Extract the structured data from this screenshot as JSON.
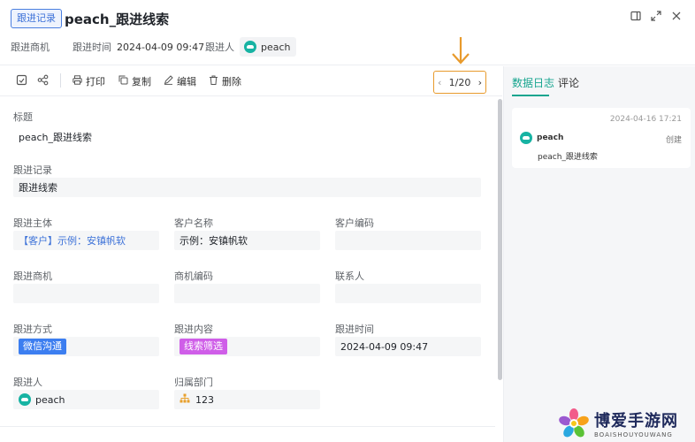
{
  "header": {
    "badge": "跟进记录",
    "title": "peach_跟进线索",
    "meta": {
      "opportunity_label": "跟进商机",
      "time_label": "跟进时间",
      "time_value": "2024-04-09 09:47",
      "person_label": "跟进人",
      "person_value": "peach"
    }
  },
  "toolbar": {
    "print": "打印",
    "copy": "复制",
    "edit": "编辑",
    "delete": "删除",
    "pager": "1/20"
  },
  "form": {
    "title_label": "标题",
    "title_value": "peach_跟进线索",
    "record_label": "跟进记录",
    "record_value": "跟进线索",
    "subject_label": "跟进主体",
    "subject_value": "【客户】示例：安镇帆软",
    "customer_name_label": "客户名称",
    "customer_name_value": "示例：安镇帆软",
    "customer_code_label": "客户编码",
    "customer_code_value": "",
    "opportunity_label": "跟进商机",
    "opportunity_value": "",
    "opportunity_code_label": "商机编码",
    "opportunity_code_value": "",
    "contact_label": "联系人",
    "contact_value": "",
    "method_label": "跟进方式",
    "method_value": "微信沟通",
    "content_label": "跟进内容",
    "content_value": "线索筛选",
    "followup_time_label": "跟进时间",
    "followup_time_value": "2024-04-09 09:47",
    "person_label": "跟进人",
    "person_value": "peach",
    "department_label": "归属部门",
    "department_value": "123"
  },
  "side": {
    "tabs": [
      "数据日志",
      "评论"
    ],
    "active_tab": "数据日志",
    "log": {
      "time": "2024-04-16 17:21",
      "user": "peach",
      "action": "创建",
      "text": "peach_跟进线索"
    }
  },
  "watermark": {
    "title": "博爱手游网",
    "subtitle": "BOAISHOUYOUWANG"
  },
  "colors": {
    "accent": "#17a58f",
    "link": "#3d72d8",
    "tag_blue": "#3c7ef0",
    "tag_purple": "#cf5ee8",
    "pager_border": "#e89a2c"
  }
}
